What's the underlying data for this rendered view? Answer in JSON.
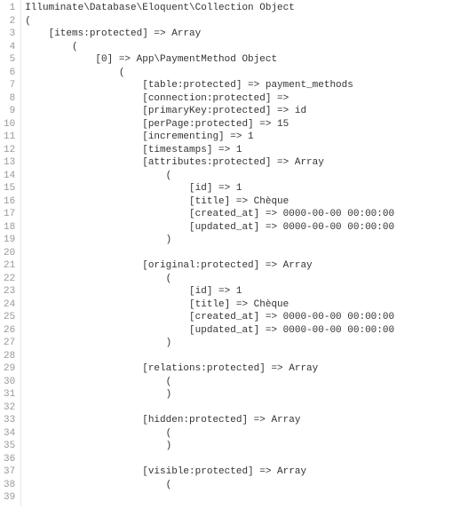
{
  "lines": [
    "Illuminate\\Database\\Eloquent\\Collection Object",
    "(",
    "    [items:protected] => Array",
    "        (",
    "            [0] => App\\PaymentMethod Object",
    "                (",
    "                    [table:protected] => payment_methods",
    "                    [connection:protected] =>",
    "                    [primaryKey:protected] => id",
    "                    [perPage:protected] => 15",
    "                    [incrementing] => 1",
    "                    [timestamps] => 1",
    "                    [attributes:protected] => Array",
    "                        (",
    "                            [id] => 1",
    "                            [title] => Chèque",
    "                            [created_at] => 0000-00-00 00:00:00",
    "                            [updated_at] => 0000-00-00 00:00:00",
    "                        )",
    "",
    "                    [original:protected] => Array",
    "                        (",
    "                            [id] => 1",
    "                            [title] => Chèque",
    "                            [created_at] => 0000-00-00 00:00:00",
    "                            [updated_at] => 0000-00-00 00:00:00",
    "                        )",
    "",
    "                    [relations:protected] => Array",
    "                        (",
    "                        )",
    "",
    "                    [hidden:protected] => Array",
    "                        (",
    "                        )",
    "",
    "                    [visible:protected] => Array",
    "                        (",
    ""
  ]
}
